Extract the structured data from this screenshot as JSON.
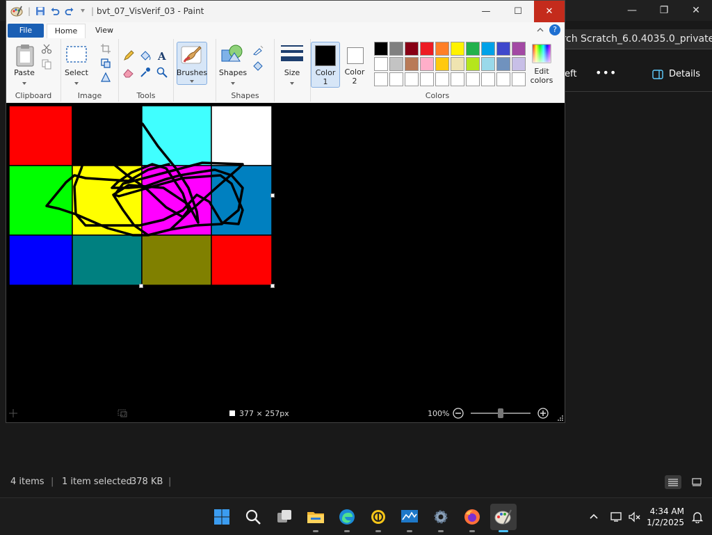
{
  "explorer": {
    "search_text": "arch Scratch_6.0.4035.0_private",
    "cmd_left": "eft",
    "cmd_more": "•••",
    "details_label": "Details",
    "status_items": "4 items",
    "status_sep": "|",
    "status_selected": "1 item selected",
    "status_size": "378 KB",
    "window_controls": {
      "minimize": "—",
      "restore": "❐",
      "close": "✕"
    }
  },
  "paint": {
    "title": "bvt_07_VisVerif_03 - Paint",
    "title_sep": "|",
    "window_controls": {
      "minimize": "—",
      "maximize": "☐",
      "close": "✕"
    },
    "tabs": {
      "file": "File",
      "home": "Home",
      "view": "View"
    },
    "help": "?",
    "groups": {
      "clipboard": {
        "label": "Clipboard",
        "paste": "Paste"
      },
      "image": {
        "label": "Image",
        "select": "Select"
      },
      "tools": {
        "label": "Tools"
      },
      "brushes": {
        "label": "Brushes"
      },
      "shapes": {
        "label": "Shapes",
        "shapes": "Shapes"
      },
      "size": {
        "label": "Size"
      },
      "colors": {
        "label": "Colors",
        "color1": "Color",
        "color1_num": "1",
        "color2": "Color",
        "color2_num": "2",
        "edit_colors_1": "Edit",
        "edit_colors_2": "colors"
      }
    },
    "palette": [
      "#000000",
      "#7f7f7f",
      "#880015",
      "#ed1c24",
      "#ff7f27",
      "#fff200",
      "#22b14c",
      "#00a2e8",
      "#3f48cc",
      "#a349a4",
      "#ffffff",
      "#c3c3c3",
      "#b97a57",
      "#ffaec9",
      "#ffc90e",
      "#efe4b0",
      "#b5e61d",
      "#99d9ea",
      "#7092be",
      "#c8bfe7"
    ],
    "color1": "#000000",
    "color2": "#ffffff",
    "canvas_grid": [
      [
        "#ff0000",
        "#000000",
        "#40ffff",
        "#ffffff"
      ],
      [
        "#00ff00",
        "#ffff00",
        "#ff00ff",
        "#0080c0"
      ],
      [
        "#0000ff",
        "#008080",
        "#808000",
        "#ff0000"
      ]
    ],
    "status": {
      "size": "377 × 257px",
      "zoom": "100%",
      "zoom_level": 0.5
    }
  },
  "taskbar": {
    "time": "4:34 AM",
    "date": "1/2/2025"
  }
}
